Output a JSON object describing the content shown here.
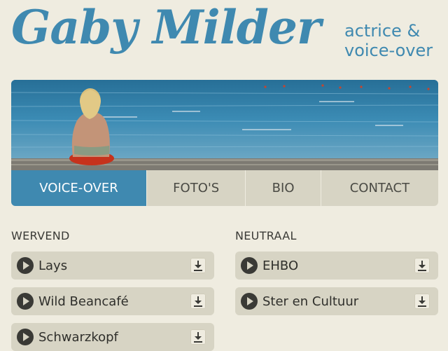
{
  "header": {
    "title": "Gaby Milder",
    "subtitle_line1": "actrice &",
    "subtitle_line2": "voice-over"
  },
  "banner": {
    "alt": "Woman sitting on a pebble beach facing the sea"
  },
  "nav": {
    "items": [
      {
        "label": "VOICE-OVER",
        "active": true
      },
      {
        "label": "FOTO'S",
        "active": false
      },
      {
        "label": "BIO",
        "active": false
      },
      {
        "label": "CONTACT",
        "active": false
      }
    ]
  },
  "sections": {
    "left": {
      "title": "WERVEND",
      "tracks": [
        "Lays",
        "Wild Beancafé",
        "Schwarzkopf"
      ]
    },
    "right": {
      "title": "NEUTRAAL",
      "tracks": [
        "EHBO",
        "Ster en Cultuur"
      ]
    }
  },
  "colors": {
    "accent": "#3f89b0",
    "background": "#efece0",
    "button": "#d7d4c4"
  },
  "icons": {
    "play": "play-icon",
    "download": "download-icon"
  }
}
